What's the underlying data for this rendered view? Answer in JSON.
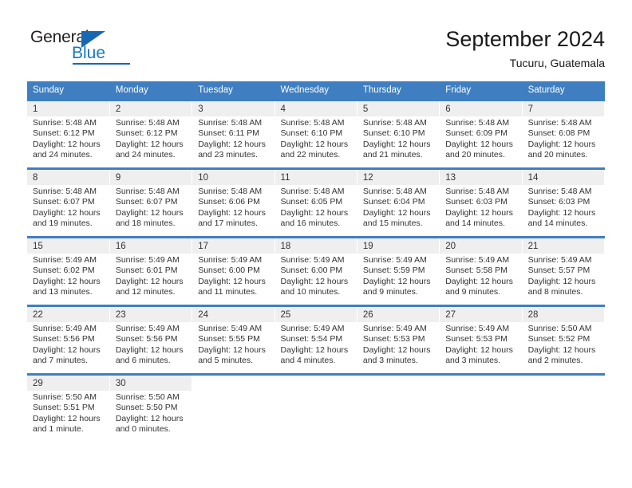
{
  "logo": {
    "word_top": "General",
    "word_bottom": "Blue",
    "triangle_icon": "blue-triangle-icon"
  },
  "header": {
    "title": "September 2024",
    "subtitle": "Tucuru, Guatemala"
  },
  "colors": {
    "header_blue": "#3f7fc1",
    "daynum_band": "#efefef",
    "logo_blue": "#1668b3",
    "text": "#333333"
  },
  "calendar": {
    "weekday_headers": [
      "Sunday",
      "Monday",
      "Tuesday",
      "Wednesday",
      "Thursday",
      "Friday",
      "Saturday"
    ],
    "weeks": [
      [
        {
          "day": "1",
          "lines": [
            "Sunrise: 5:48 AM",
            "Sunset: 6:12 PM",
            "Daylight: 12 hours",
            "and 24 minutes."
          ]
        },
        {
          "day": "2",
          "lines": [
            "Sunrise: 5:48 AM",
            "Sunset: 6:12 PM",
            "Daylight: 12 hours",
            "and 24 minutes."
          ]
        },
        {
          "day": "3",
          "lines": [
            "Sunrise: 5:48 AM",
            "Sunset: 6:11 PM",
            "Daylight: 12 hours",
            "and 23 minutes."
          ]
        },
        {
          "day": "4",
          "lines": [
            "Sunrise: 5:48 AM",
            "Sunset: 6:10 PM",
            "Daylight: 12 hours",
            "and 22 minutes."
          ]
        },
        {
          "day": "5",
          "lines": [
            "Sunrise: 5:48 AM",
            "Sunset: 6:10 PM",
            "Daylight: 12 hours",
            "and 21 minutes."
          ]
        },
        {
          "day": "6",
          "lines": [
            "Sunrise: 5:48 AM",
            "Sunset: 6:09 PM",
            "Daylight: 12 hours",
            "and 20 minutes."
          ]
        },
        {
          "day": "7",
          "lines": [
            "Sunrise: 5:48 AM",
            "Sunset: 6:08 PM",
            "Daylight: 12 hours",
            "and 20 minutes."
          ]
        }
      ],
      [
        {
          "day": "8",
          "lines": [
            "Sunrise: 5:48 AM",
            "Sunset: 6:07 PM",
            "Daylight: 12 hours",
            "and 19 minutes."
          ]
        },
        {
          "day": "9",
          "lines": [
            "Sunrise: 5:48 AM",
            "Sunset: 6:07 PM",
            "Daylight: 12 hours",
            "and 18 minutes."
          ]
        },
        {
          "day": "10",
          "lines": [
            "Sunrise: 5:48 AM",
            "Sunset: 6:06 PM",
            "Daylight: 12 hours",
            "and 17 minutes."
          ]
        },
        {
          "day": "11",
          "lines": [
            "Sunrise: 5:48 AM",
            "Sunset: 6:05 PM",
            "Daylight: 12 hours",
            "and 16 minutes."
          ]
        },
        {
          "day": "12",
          "lines": [
            "Sunrise: 5:48 AM",
            "Sunset: 6:04 PM",
            "Daylight: 12 hours",
            "and 15 minutes."
          ]
        },
        {
          "day": "13",
          "lines": [
            "Sunrise: 5:48 AM",
            "Sunset: 6:03 PM",
            "Daylight: 12 hours",
            "and 14 minutes."
          ]
        },
        {
          "day": "14",
          "lines": [
            "Sunrise: 5:48 AM",
            "Sunset: 6:03 PM",
            "Daylight: 12 hours",
            "and 14 minutes."
          ]
        }
      ],
      [
        {
          "day": "15",
          "lines": [
            "Sunrise: 5:49 AM",
            "Sunset: 6:02 PM",
            "Daylight: 12 hours",
            "and 13 minutes."
          ]
        },
        {
          "day": "16",
          "lines": [
            "Sunrise: 5:49 AM",
            "Sunset: 6:01 PM",
            "Daylight: 12 hours",
            "and 12 minutes."
          ]
        },
        {
          "day": "17",
          "lines": [
            "Sunrise: 5:49 AM",
            "Sunset: 6:00 PM",
            "Daylight: 12 hours",
            "and 11 minutes."
          ]
        },
        {
          "day": "18",
          "lines": [
            "Sunrise: 5:49 AM",
            "Sunset: 6:00 PM",
            "Daylight: 12 hours",
            "and 10 minutes."
          ]
        },
        {
          "day": "19",
          "lines": [
            "Sunrise: 5:49 AM",
            "Sunset: 5:59 PM",
            "Daylight: 12 hours",
            "and 9 minutes."
          ]
        },
        {
          "day": "20",
          "lines": [
            "Sunrise: 5:49 AM",
            "Sunset: 5:58 PM",
            "Daylight: 12 hours",
            "and 9 minutes."
          ]
        },
        {
          "day": "21",
          "lines": [
            "Sunrise: 5:49 AM",
            "Sunset: 5:57 PM",
            "Daylight: 12 hours",
            "and 8 minutes."
          ]
        }
      ],
      [
        {
          "day": "22",
          "lines": [
            "Sunrise: 5:49 AM",
            "Sunset: 5:56 PM",
            "Daylight: 12 hours",
            "and 7 minutes."
          ]
        },
        {
          "day": "23",
          "lines": [
            "Sunrise: 5:49 AM",
            "Sunset: 5:56 PM",
            "Daylight: 12 hours",
            "and 6 minutes."
          ]
        },
        {
          "day": "24",
          "lines": [
            "Sunrise: 5:49 AM",
            "Sunset: 5:55 PM",
            "Daylight: 12 hours",
            "and 5 minutes."
          ]
        },
        {
          "day": "25",
          "lines": [
            "Sunrise: 5:49 AM",
            "Sunset: 5:54 PM",
            "Daylight: 12 hours",
            "and 4 minutes."
          ]
        },
        {
          "day": "26",
          "lines": [
            "Sunrise: 5:49 AM",
            "Sunset: 5:53 PM",
            "Daylight: 12 hours",
            "and 3 minutes."
          ]
        },
        {
          "day": "27",
          "lines": [
            "Sunrise: 5:49 AM",
            "Sunset: 5:53 PM",
            "Daylight: 12 hours",
            "and 3 minutes."
          ]
        },
        {
          "day": "28",
          "lines": [
            "Sunrise: 5:50 AM",
            "Sunset: 5:52 PM",
            "Daylight: 12 hours",
            "and 2 minutes."
          ]
        }
      ],
      [
        {
          "day": "29",
          "lines": [
            "Sunrise: 5:50 AM",
            "Sunset: 5:51 PM",
            "Daylight: 12 hours",
            "and 1 minute."
          ]
        },
        {
          "day": "30",
          "lines": [
            "Sunrise: 5:50 AM",
            "Sunset: 5:50 PM",
            "Daylight: 12 hours",
            "and 0 minutes."
          ]
        },
        {
          "day": "",
          "lines": []
        },
        {
          "day": "",
          "lines": []
        },
        {
          "day": "",
          "lines": []
        },
        {
          "day": "",
          "lines": []
        },
        {
          "day": "",
          "lines": []
        }
      ]
    ]
  }
}
